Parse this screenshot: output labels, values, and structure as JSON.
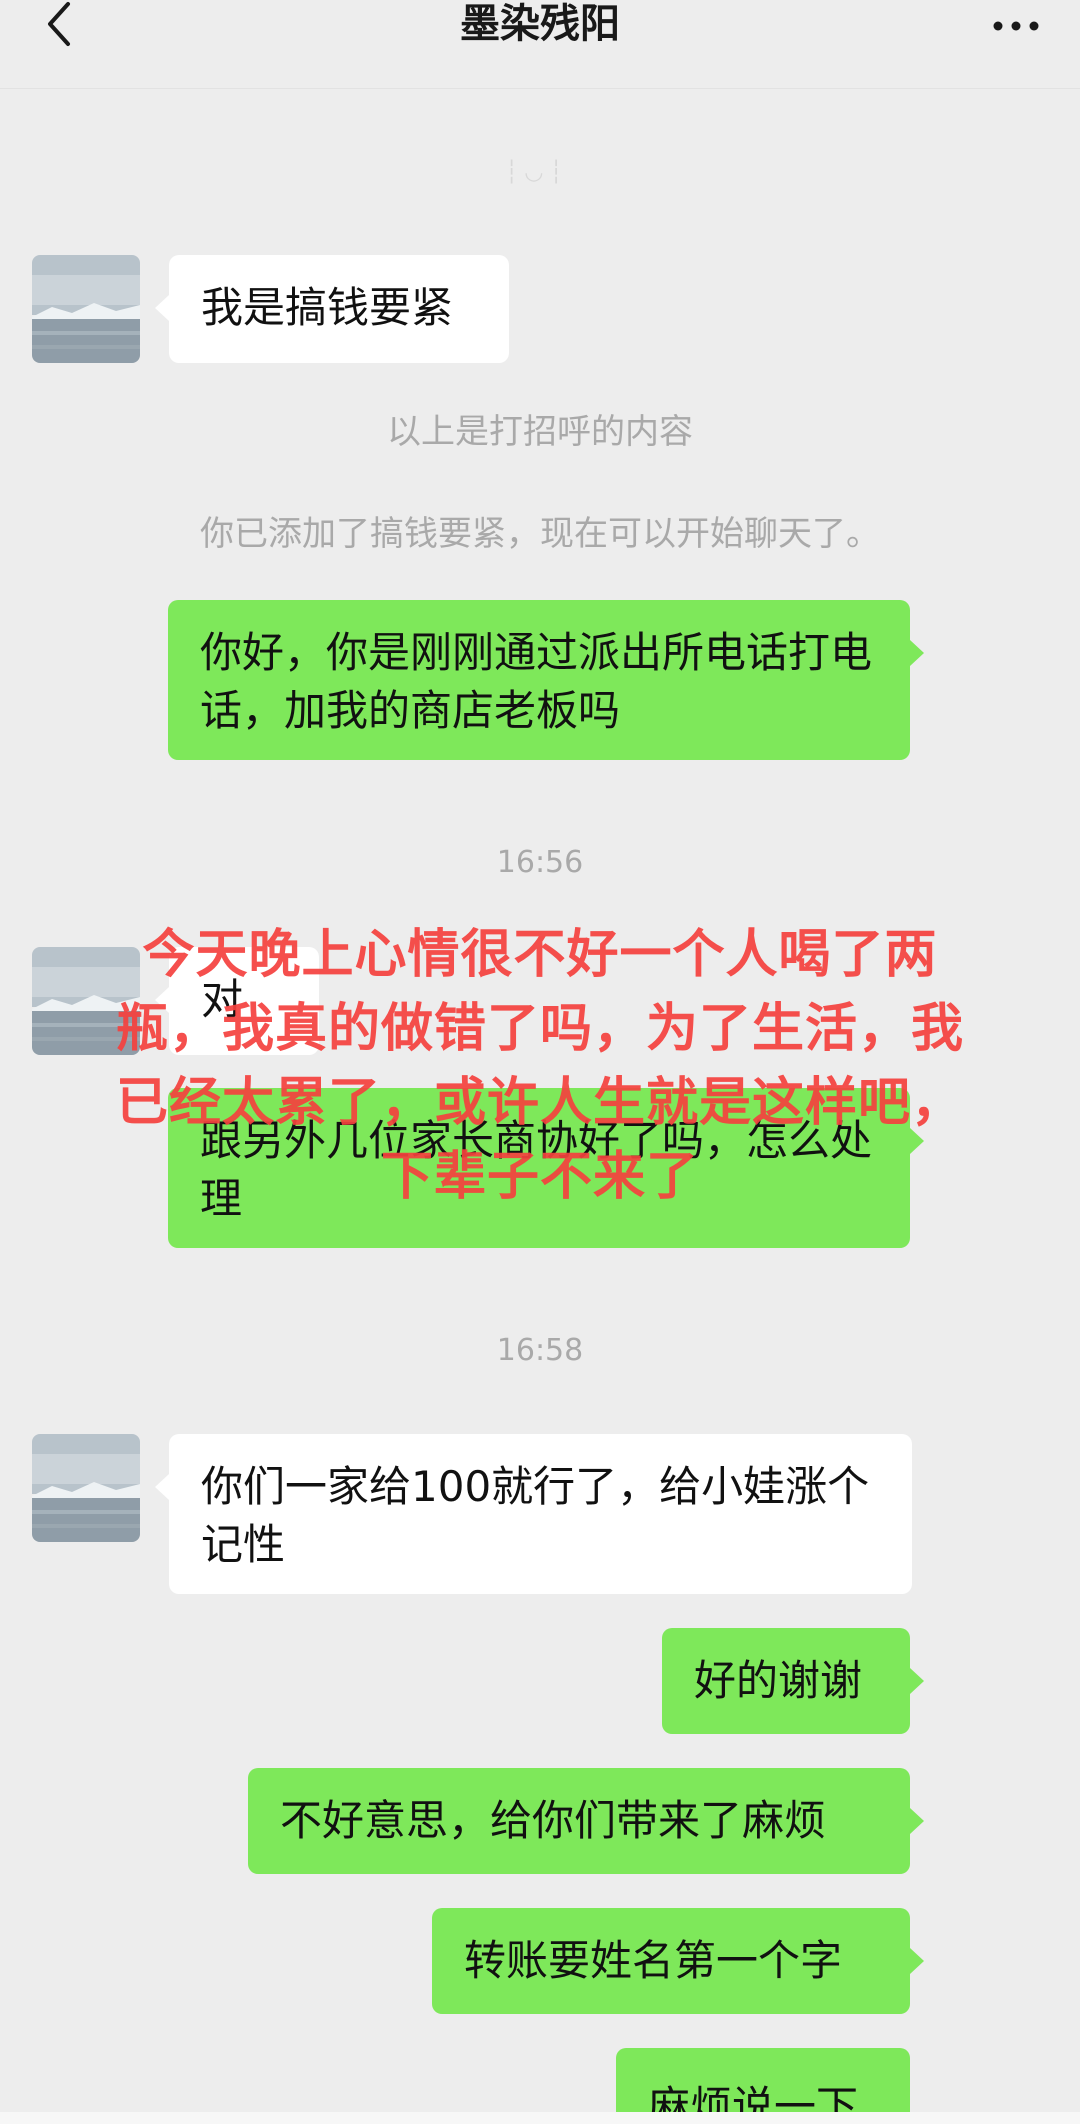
{
  "header": {
    "title": "墨染残阳"
  },
  "faint_text": "┆◡┆",
  "messages": [
    {
      "text": "我是搞钱要紧"
    },
    {
      "text": "以上是打招呼的内容"
    },
    {
      "text": "你已添加了搞钱要紧，现在可以开始聊天了。"
    },
    {
      "text": "你好，你是刚刚通过派出所电话打电话，加我的商店老板吗"
    },
    {
      "text": "16:56"
    },
    {
      "text": "对"
    },
    {
      "text": "跟另外几位家长商协好了吗，怎么处理"
    },
    {
      "text": "16:58"
    },
    {
      "text": "你们一家给100就行了，给小娃涨个记性"
    },
    {
      "text": "好的谢谢"
    },
    {
      "text": "不好意思，给你们带来了麻烦"
    },
    {
      "text": "转账要姓名第一个字"
    },
    {
      "text": "麻烦说一下"
    }
  ],
  "overlay_text": "今天晚上心情很不好一个人喝了两瓶，我真的做错了吗，为了生活，我已经太累了，或许人生就是这样吧，下辈子不来了",
  "colors": {
    "background": "#EDEDED",
    "outgoing_bubble": "#7EE85A",
    "incoming_bubble": "#FFFFFF",
    "overlay_text": "#F5413E"
  }
}
